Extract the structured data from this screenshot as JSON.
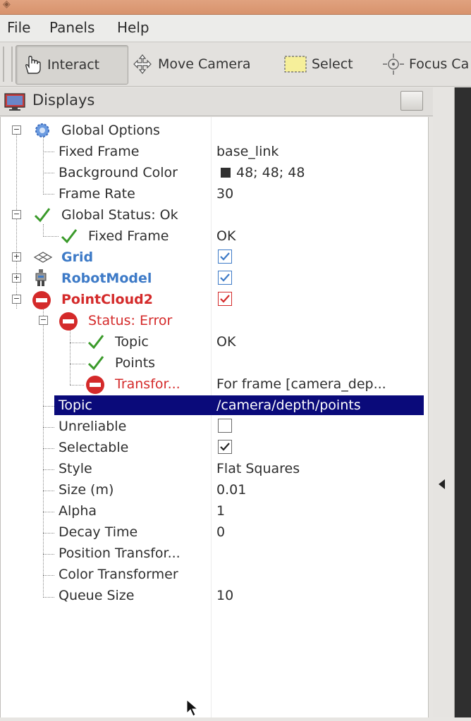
{
  "menubar": {
    "file": "File",
    "panels": "Panels",
    "help": "Help"
  },
  "toolbar": {
    "interact": {
      "label": "Interact",
      "icon": "hand-icon"
    },
    "move_camera": {
      "label": "Move Camera",
      "icon": "move-arrows-icon"
    },
    "select": {
      "label": "Select",
      "icon": "select-rect-icon"
    },
    "focus_camera": {
      "label": "Focus Ca",
      "icon": "focus-target-icon"
    }
  },
  "displays_panel": {
    "title": "Displays",
    "icon": "monitor-icon"
  },
  "tree": {
    "global_options": {
      "label": "Global Options",
      "fixed_frame": {
        "label": "Fixed Frame",
        "value": "base_link"
      },
      "background_color": {
        "label": "Background Color",
        "value": "48; 48; 48",
        "swatch": "#303030"
      },
      "frame_rate": {
        "label": "Frame Rate",
        "value": "30"
      }
    },
    "global_status": {
      "label": "Global Status: Ok",
      "fixed_frame": {
        "label": "Fixed Frame",
        "value": "OK"
      }
    },
    "grid": {
      "label": "Grid",
      "checked": true
    },
    "robot_model": {
      "label": "RobotModel",
      "checked": true
    },
    "pointcloud2": {
      "label": "PointCloud2",
      "checked": true,
      "status": {
        "label": "Status: Error",
        "topic": {
          "label": "Topic",
          "value": "OK"
        },
        "points": {
          "label": "Points",
          "value": ""
        },
        "transform": {
          "label": "Transfor...",
          "value": "For frame [camera_dep..."
        }
      },
      "topic": {
        "label": "Topic",
        "value": "/camera/depth/points"
      },
      "unreliable": {
        "label": "Unreliable",
        "checked": false
      },
      "selectable": {
        "label": "Selectable",
        "checked": true
      },
      "style": {
        "label": "Style",
        "value": "Flat Squares"
      },
      "size": {
        "label": "Size (m)",
        "value": "0.01"
      },
      "alpha": {
        "label": "Alpha",
        "value": "1"
      },
      "decay_time": {
        "label": "Decay Time",
        "value": "0"
      },
      "position_transformer": {
        "label": "Position Transfor...",
        "value": ""
      },
      "color_transformer": {
        "label": "Color Transformer",
        "value": ""
      },
      "queue_size": {
        "label": "Queue Size",
        "value": "10"
      }
    }
  },
  "colors": {
    "title_bar": "#d8936d",
    "enabled_display": "#3d7ac7",
    "error": "#d42a2a",
    "ok_check": "#3a9a2a",
    "selection": "#0a0a7a"
  }
}
